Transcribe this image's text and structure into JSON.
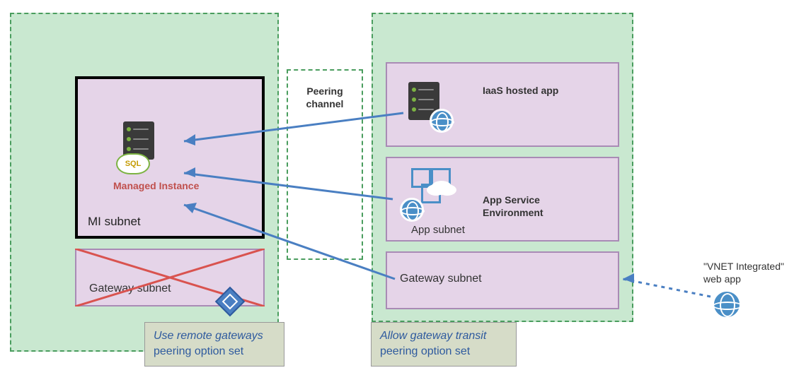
{
  "left_vnet": {
    "mi_subnet_label": "MI subnet",
    "managed_instance_label": "Managed Instance",
    "sql_badge": "SQL",
    "gateway_subnet_label": "Gateway subnet"
  },
  "peering": {
    "label_line1": "Peering",
    "label_line2": "channel"
  },
  "right_vnet": {
    "iaas_label": "IaaS hosted app",
    "app_service_env_label1": "App Service",
    "app_service_env_label2": "Environment",
    "app_subnet_label": "App subnet",
    "gateway_subnet_label": "Gateway subnet"
  },
  "captions": {
    "left_italic": "Use remote gateways",
    "left_plain": "peering option set",
    "right_italic": "Allow gateway transit",
    "right_plain": "peering option set"
  },
  "external": {
    "label_line1": "\"VNET Integrated\"",
    "label_line2": "web app"
  },
  "colors": {
    "green_fill": "#c9e8d0",
    "green_border": "#4a9d5e",
    "purple_fill": "#e5d4e8",
    "purple_border": "#a98bb5",
    "blue": "#4a7fc2",
    "red": "#d9534f",
    "caption_bg": "#d6dcc8"
  }
}
